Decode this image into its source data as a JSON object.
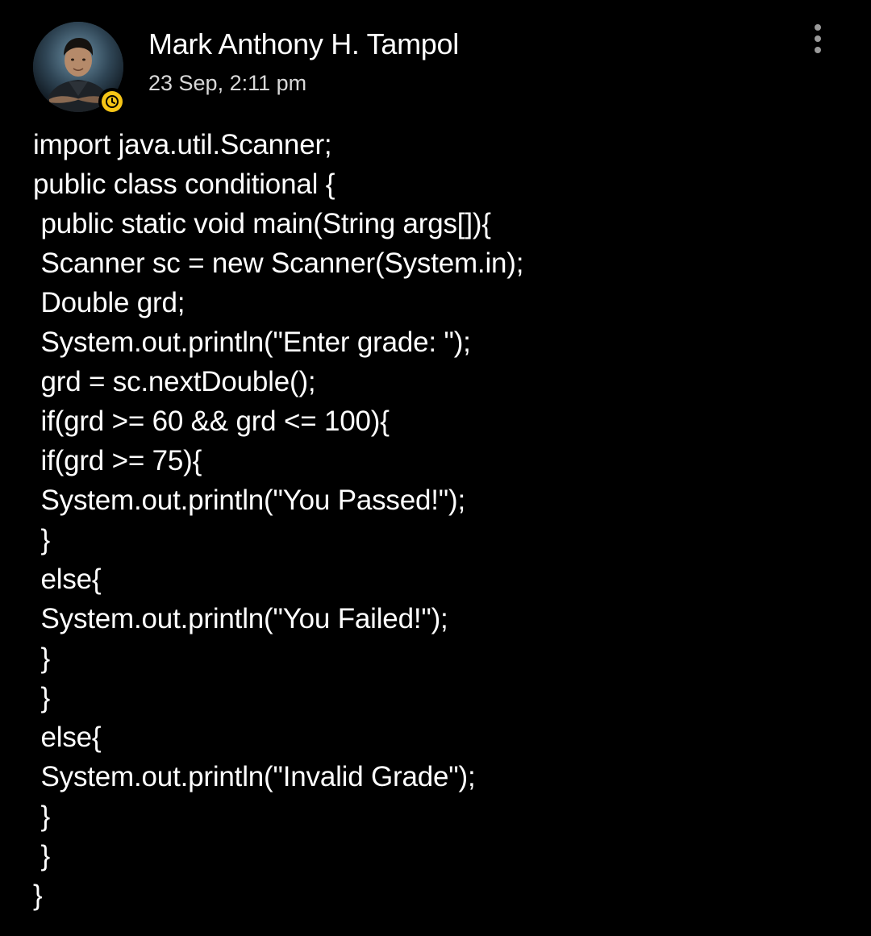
{
  "post": {
    "author_name": "Mark Anthony H. Tampol",
    "timestamp": "23 Sep, 2:11 pm",
    "avatar_icon": "profile-photo",
    "status_icon": "clock-icon",
    "status_color": "#f6c516",
    "more_icon": "more-vertical-icon",
    "lines": [
      "import java.util.Scanner;",
      "public class conditional {",
      " public static void main(String args[]){",
      " Scanner sc = new Scanner(System.in);",
      " Double grd;",
      " System.out.println(\"Enter grade: \");",
      " grd = sc.nextDouble();",
      " if(grd >= 60 && grd <= 100){",
      " if(grd >= 75){",
      " System.out.println(\"You Passed!\");",
      " }",
      " else{",
      " System.out.println(\"You Failed!\");",
      " }",
      " }",
      " else{",
      " System.out.println(\"Invalid Grade\");",
      " }",
      " }",
      "}"
    ]
  }
}
